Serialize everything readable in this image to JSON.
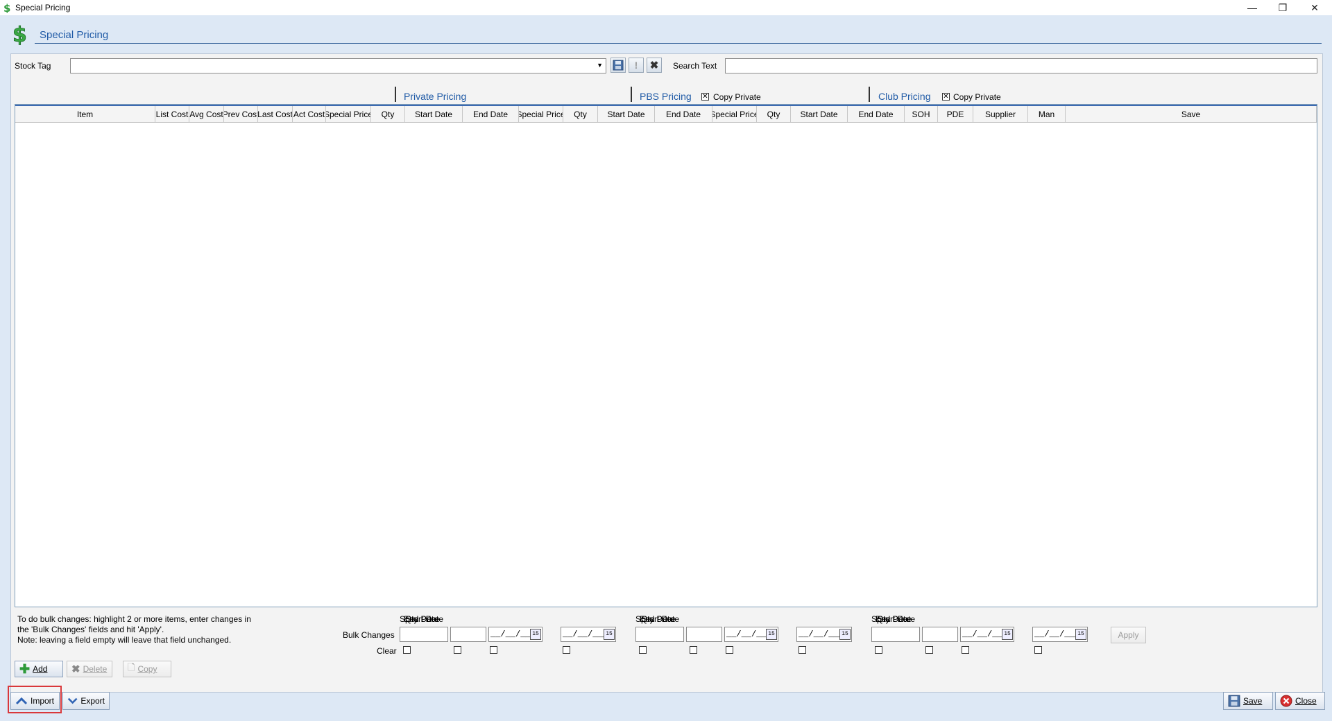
{
  "window": {
    "title": "Special Pricing",
    "controls": {
      "minimize": "—",
      "restore": "❐",
      "close": "✕"
    }
  },
  "header": {
    "title": "Special Pricing",
    "icon": "dollar-icon"
  },
  "filters": {
    "stock_tag_label": "Stock Tag",
    "stock_tag_value": "",
    "search_text_label": "Search Text",
    "search_text_value": ""
  },
  "groups": {
    "private": {
      "title": "Private Pricing"
    },
    "pbs": {
      "title": "PBS Pricing",
      "copy_private_label": "Copy Private",
      "copy_private_checked": true
    },
    "club": {
      "title": "Club Pricing",
      "copy_private_label": "Copy Private",
      "copy_private_checked": true
    }
  },
  "grid": {
    "columns": [
      "Item",
      "List Cost",
      "Avg Cost",
      "Prev Cost",
      "Last Cost",
      "Act Cost",
      "Special Price",
      "Qty",
      "Start Date",
      "End Date",
      "Special Price",
      "Qty",
      "Start Date",
      "End Date",
      "Special Price",
      "Qty",
      "Start Date",
      "End Date",
      "SOH",
      "PDE",
      "Supplier",
      "Man",
      "Save"
    ],
    "rows": []
  },
  "bulk": {
    "note_lines": [
      "To do bulk changes: highlight 2 or more items, enter changes in",
      "the 'Bulk Changes' fields and hit 'Apply'.",
      "Note: leaving a field empty will leave that field unchanged."
    ],
    "bulk_changes_label": "Bulk Changes",
    "clear_label": "Clear",
    "headers": [
      "Spec Price",
      "Qty",
      "Start Date",
      "End Date",
      "Spec Price",
      "Qty",
      "Start Date",
      "End Date",
      "Spec Price",
      "Qty",
      "Start Date",
      "End Date"
    ],
    "date_placeholder": "__/__/____",
    "calendar_glyph": "15",
    "apply_label": "Apply"
  },
  "actions": {
    "add_label": "Add",
    "delete_label": "Delete",
    "copy_label": "Copy",
    "import_label": "Import",
    "export_label": "Export",
    "save_label": "Save",
    "close_label": "Close"
  }
}
